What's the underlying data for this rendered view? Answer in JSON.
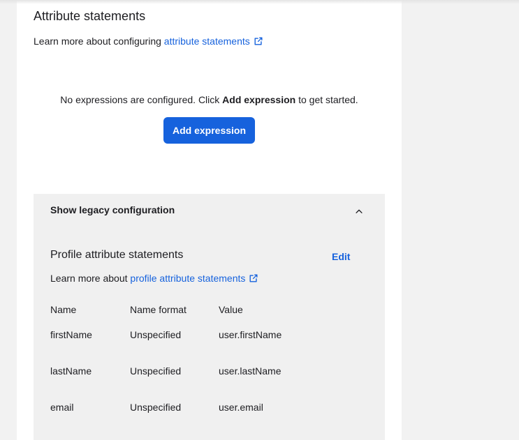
{
  "attribute_statements": {
    "title": "Attribute statements",
    "learn_prefix": "Learn more about configuring ",
    "learn_link": "attribute statements",
    "empty_prefix": "No expressions are configured. Click ",
    "empty_bold": "Add expression",
    "empty_suffix": " to get started.",
    "add_button": "Add expression"
  },
  "legacy": {
    "toggle_label": "Show legacy configuration",
    "profile_title": "Profile attribute statements",
    "edit_label": "Edit",
    "learn_prefix": "Learn more about ",
    "learn_link": "profile attribute statements",
    "columns": [
      "Name",
      "Name format",
      "Value"
    ],
    "rows": [
      {
        "name": "firstName",
        "format": "Unspecified",
        "value": "user.firstName"
      },
      {
        "name": "lastName",
        "format": "Unspecified",
        "value": "user.lastName"
      },
      {
        "name": "email",
        "format": "Unspecified",
        "value": "user.email"
      }
    ]
  },
  "colors": {
    "accent": "#1662dd",
    "page_bg": "#f2f2f2",
    "panel_bg": "#f0f0f0"
  },
  "icons": {
    "external_link": "external-link-icon",
    "collapse": "chevron-up-icon"
  }
}
